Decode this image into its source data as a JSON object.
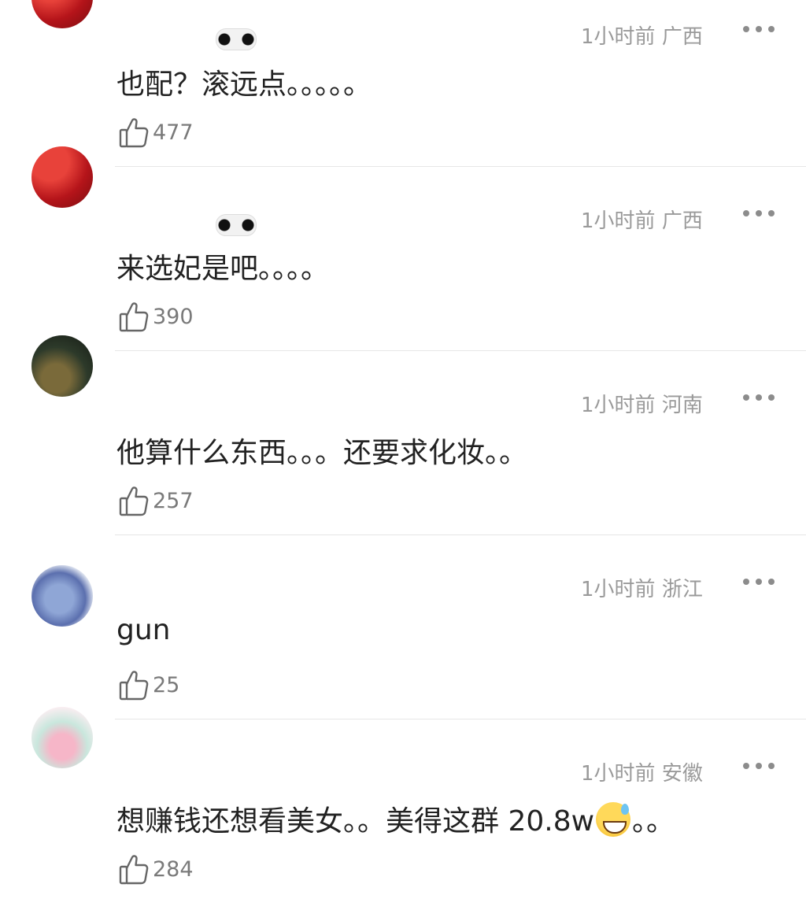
{
  "colors": {
    "background": "#ffffff",
    "text": "#222222",
    "meta": "#9a9a9a",
    "divider": "#e6e6e6"
  },
  "comments": [
    {
      "time": "1小时前",
      "location": "广西",
      "text": "也配？滚远点。。。。。",
      "likes": "477",
      "avatar_icon": "avatar-red-image"
    },
    {
      "time": "1小时前",
      "location": "广西",
      "text": "来选妃是吧。。。。",
      "likes": "390",
      "avatar_icon": "avatar-red-image"
    },
    {
      "time": "1小时前",
      "location": "河南",
      "text": "他算什么东西。。。还要求化妆。。",
      "likes": "257",
      "avatar_icon": "avatar-dark-image"
    },
    {
      "time": "1小时前",
      "location": "浙江",
      "text": "gun",
      "likes": "25",
      "avatar_icon": "avatar-donkey-image"
    },
    {
      "time": "1小时前",
      "location": "安徽",
      "text_before_emoji": "想赚钱还想看美女。。美得这群 20.8w",
      "emoji": "sweat-smile-emoji",
      "text_after_emoji": "。。",
      "likes": "284",
      "avatar_icon": "avatar-pink-image"
    }
  ]
}
